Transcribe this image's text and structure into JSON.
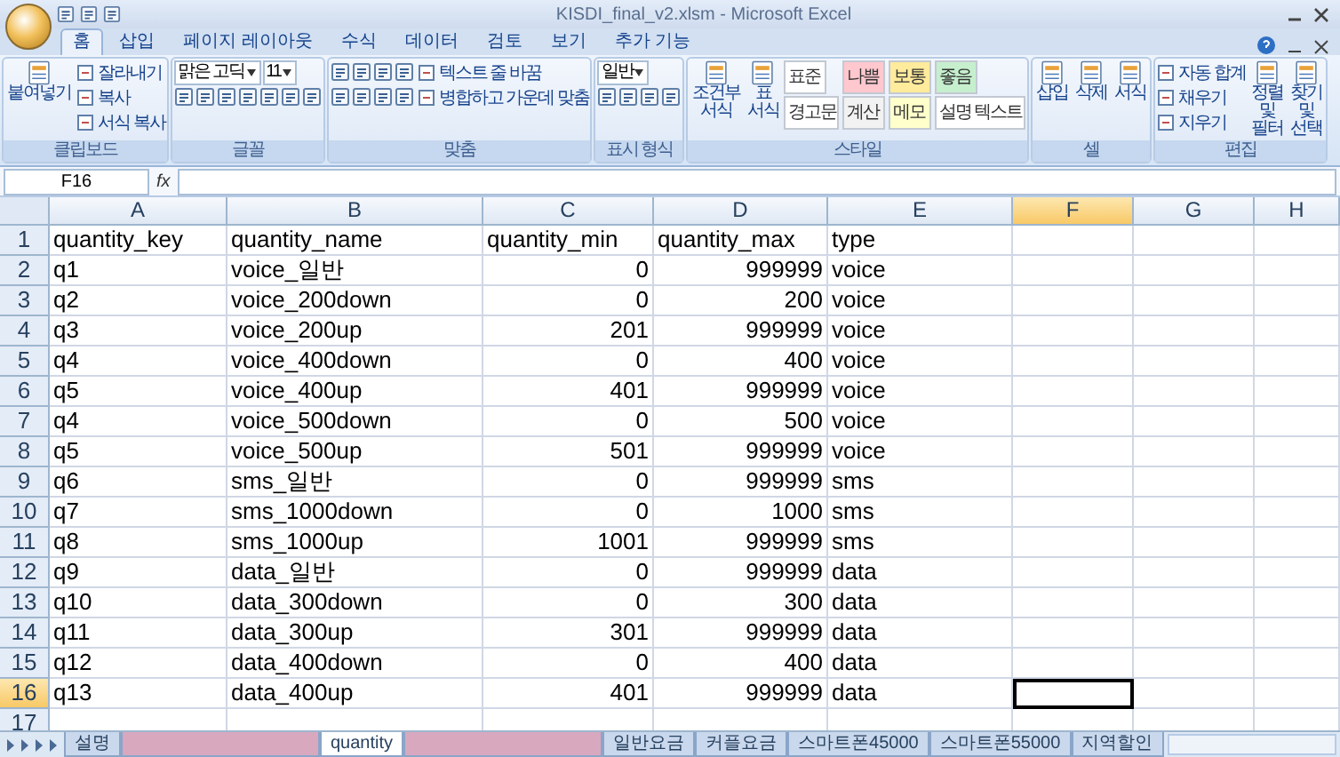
{
  "window": {
    "title": "KISDI_final_v2.xlsm - Microsoft Excel"
  },
  "ribbon": {
    "tabs": [
      {
        "label": "홈",
        "selected": true
      },
      {
        "label": "삽입",
        "selected": false
      },
      {
        "label": "페이지 레이아웃",
        "selected": false
      },
      {
        "label": "수식",
        "selected": false
      },
      {
        "label": "데이터",
        "selected": false
      },
      {
        "label": "검토",
        "selected": false
      },
      {
        "label": "보기",
        "selected": false
      },
      {
        "label": "추가 기능",
        "selected": false
      }
    ],
    "groups": [
      {
        "label": "클립보드",
        "columns": [
          [
            [
              {
                "kind": "large",
                "label": "붙여넣기"
              }
            ]
          ],
          [
            [
              {
                "kind": "small",
                "label": "잘라내기"
              }
            ],
            [
              {
                "kind": "small",
                "label": "복사"
              }
            ],
            [
              {
                "kind": "small",
                "label": "서식 복사"
              }
            ]
          ]
        ]
      },
      {
        "label": "글꼴",
        "columns": [
          [
            [
              {
                "kind": "select",
                "value": "맑은 고딕"
              },
              {
                "kind": "select",
                "value": "11"
              }
            ],
            [
              {
                "kind": "icon"
              },
              {
                "kind": "icon"
              },
              {
                "kind": "icon"
              },
              {
                "kind": "icon"
              },
              {
                "kind": "icon"
              },
              {
                "kind": "icon"
              },
              {
                "kind": "icon"
              }
            ]
          ]
        ]
      },
      {
        "label": "맞춤",
        "columns": [
          [
            [
              {
                "kind": "icon"
              },
              {
                "kind": "icon"
              },
              {
                "kind": "icon"
              },
              {
                "kind": "icon"
              }
            ],
            [
              {
                "kind": "icon"
              },
              {
                "kind": "icon"
              },
              {
                "kind": "icon"
              },
              {
                "kind": "icon"
              }
            ]
          ],
          [
            [
              {
                "kind": "small",
                "label": "텍스트 줄 바꿈"
              }
            ],
            [
              {
                "kind": "small",
                "label": "병합하고 가운데 맞춤"
              }
            ]
          ]
        ]
      },
      {
        "label": "표시 형식",
        "columns": [
          [
            [
              {
                "kind": "select",
                "value": "일반"
              }
            ],
            [
              {
                "kind": "icon"
              },
              {
                "kind": "icon"
              },
              {
                "kind": "icon"
              },
              {
                "kind": "icon"
              }
            ]
          ]
        ]
      },
      {
        "label": "스타일",
        "columns": [
          [
            [
              {
                "kind": "large",
                "label": "조건부 서식"
              }
            ]
          ],
          [
            [
              {
                "kind": "large",
                "label": "표 서식"
              }
            ]
          ],
          [
            [
              {
                "kind": "style",
                "label": "표준",
                "color": "#ffffff"
              }
            ],
            [
              {
                "kind": "style",
                "label": "경고문",
                "color": "#ffffff"
              }
            ]
          ],
          [
            [
              {
                "kind": "style",
                "label": "나쁨",
                "color": "#ffc7ce"
              }
            ],
            [
              {
                "kind": "style",
                "label": "계산",
                "color": "#f2f2f2"
              }
            ]
          ],
          [
            [
              {
                "kind": "style",
                "label": "보통",
                "color": "#ffeb9c"
              }
            ],
            [
              {
                "kind": "style",
                "label": "메모",
                "color": "#ffffcc"
              }
            ]
          ],
          [
            [
              {
                "kind": "style",
                "label": "좋음",
                "color": "#c6efce"
              }
            ],
            [
              {
                "kind": "style",
                "label": "설명 텍스트",
                "color": "#ffffff"
              }
            ]
          ]
        ]
      },
      {
        "label": "셀",
        "columns": [
          [
            [
              {
                "kind": "large",
                "label": "삽입"
              }
            ]
          ],
          [
            [
              {
                "kind": "large",
                "label": "삭제"
              }
            ]
          ],
          [
            [
              {
                "kind": "large",
                "label": "서식"
              }
            ]
          ]
        ]
      },
      {
        "label": "편집",
        "columns": [
          [
            [
              {
                "kind": "small",
                "label": "자동 합계"
              }
            ],
            [
              {
                "kind": "small",
                "label": "채우기"
              }
            ],
            [
              {
                "kind": "small",
                "label": "지우기"
              }
            ]
          ],
          [
            [
              {
                "kind": "large",
                "label": "정렬 및 필터"
              }
            ]
          ],
          [
            [
              {
                "kind": "large",
                "label": "찾기 및 선택"
              }
            ]
          ]
        ]
      }
    ]
  },
  "formula_bar": {
    "name_box": "F16",
    "function_label": "fx"
  },
  "columns": [
    {
      "label": "A",
      "selected": false
    },
    {
      "label": "B",
      "selected": false
    },
    {
      "label": "C",
      "selected": false
    },
    {
      "label": "D",
      "selected": false
    },
    {
      "label": "E",
      "selected": false
    },
    {
      "label": "F",
      "selected": true
    },
    {
      "label": "G",
      "selected": false
    },
    {
      "label": "H",
      "selected": false
    }
  ],
  "rows": [
    {
      "number": "1",
      "selected": false,
      "cells": [
        {
          "text": "quantity_key",
          "kind": "text"
        },
        {
          "text": "quantity_name",
          "kind": "text"
        },
        {
          "text": "quantity_min",
          "kind": "text"
        },
        {
          "text": "quantity_max",
          "kind": "text"
        },
        {
          "text": "type",
          "kind": "text"
        }
      ]
    },
    {
      "number": "2",
      "selected": false,
      "cells": [
        {
          "text": "q1",
          "kind": "text"
        },
        {
          "text": "voice_일반",
          "kind": "text"
        },
        {
          "text": "0",
          "kind": "number"
        },
        {
          "text": "999999",
          "kind": "number"
        },
        {
          "text": "voice",
          "kind": "text"
        }
      ]
    },
    {
      "number": "3",
      "selected": false,
      "cells": [
        {
          "text": "q2",
          "kind": "text"
        },
        {
          "text": "voice_200down",
          "kind": "text"
        },
        {
          "text": "0",
          "kind": "number"
        },
        {
          "text": "200",
          "kind": "number"
        },
        {
          "text": "voice",
          "kind": "text"
        }
      ]
    },
    {
      "number": "4",
      "selected": false,
      "cells": [
        {
          "text": "q3",
          "kind": "text"
        },
        {
          "text": "voice_200up",
          "kind": "text"
        },
        {
          "text": "201",
          "kind": "number"
        },
        {
          "text": "999999",
          "kind": "number"
        },
        {
          "text": "voice",
          "kind": "text"
        }
      ]
    },
    {
      "number": "5",
      "selected": false,
      "cells": [
        {
          "text": "q4",
          "kind": "text"
        },
        {
          "text": "voice_400down",
          "kind": "text"
        },
        {
          "text": "0",
          "kind": "number"
        },
        {
          "text": "400",
          "kind": "number"
        },
        {
          "text": "voice",
          "kind": "text"
        }
      ]
    },
    {
      "number": "6",
      "selected": false,
      "cells": [
        {
          "text": "q5",
          "kind": "text"
        },
        {
          "text": "voice_400up",
          "kind": "text"
        },
        {
          "text": "401",
          "kind": "number"
        },
        {
          "text": "999999",
          "kind": "number"
        },
        {
          "text": "voice",
          "kind": "text"
        }
      ]
    },
    {
      "number": "7",
      "selected": false,
      "cells": [
        {
          "text": "q4",
          "kind": "text"
        },
        {
          "text": "voice_500down",
          "kind": "text"
        },
        {
          "text": "0",
          "kind": "number"
        },
        {
          "text": "500",
          "kind": "number"
        },
        {
          "text": "voice",
          "kind": "text"
        }
      ]
    },
    {
      "number": "8",
      "selected": false,
      "cells": [
        {
          "text": "q5",
          "kind": "text"
        },
        {
          "text": "voice_500up",
          "kind": "text"
        },
        {
          "text": "501",
          "kind": "number"
        },
        {
          "text": "999999",
          "kind": "number"
        },
        {
          "text": "voice",
          "kind": "text"
        }
      ]
    },
    {
      "number": "9",
      "selected": false,
      "cells": [
        {
          "text": "q6",
          "kind": "text"
        },
        {
          "text": "sms_일반",
          "kind": "text"
        },
        {
          "text": "0",
          "kind": "number"
        },
        {
          "text": "999999",
          "kind": "number"
        },
        {
          "text": "sms",
          "kind": "text"
        }
      ]
    },
    {
      "number": "10",
      "selected": false,
      "cells": [
        {
          "text": "q7",
          "kind": "text"
        },
        {
          "text": "sms_1000down",
          "kind": "text"
        },
        {
          "text": "0",
          "kind": "number"
        },
        {
          "text": "1000",
          "kind": "number"
        },
        {
          "text": "sms",
          "kind": "text"
        }
      ]
    },
    {
      "number": "11",
      "selected": false,
      "cells": [
        {
          "text": "q8",
          "kind": "text"
        },
        {
          "text": "sms_1000up",
          "kind": "text"
        },
        {
          "text": "1001",
          "kind": "number"
        },
        {
          "text": "999999",
          "kind": "number"
        },
        {
          "text": "sms",
          "kind": "text"
        }
      ]
    },
    {
      "number": "12",
      "selected": false,
      "cells": [
        {
          "text": "q9",
          "kind": "text"
        },
        {
          "text": "data_일반",
          "kind": "text"
        },
        {
          "text": "0",
          "kind": "number"
        },
        {
          "text": "999999",
          "kind": "number"
        },
        {
          "text": "data",
          "kind": "text"
        }
      ]
    },
    {
      "number": "13",
      "selected": false,
      "cells": [
        {
          "text": "q10",
          "kind": "text"
        },
        {
          "text": "data_300down",
          "kind": "text"
        },
        {
          "text": "0",
          "kind": "number"
        },
        {
          "text": "300",
          "kind": "number"
        },
        {
          "text": "data",
          "kind": "text"
        }
      ]
    },
    {
      "number": "14",
      "selected": false,
      "cells": [
        {
          "text": "q11",
          "kind": "text"
        },
        {
          "text": "data_300up",
          "kind": "text"
        },
        {
          "text": "301",
          "kind": "number"
        },
        {
          "text": "999999",
          "kind": "number"
        },
        {
          "text": "data",
          "kind": "text"
        }
      ]
    },
    {
      "number": "15",
      "selected": false,
      "cells": [
        {
          "text": "q12",
          "kind": "text"
        },
        {
          "text": "data_400down",
          "kind": "text"
        },
        {
          "text": "0",
          "kind": "number"
        },
        {
          "text": "400",
          "kind": "number"
        },
        {
          "text": "data",
          "kind": "text"
        }
      ]
    },
    {
      "number": "16",
      "selected": true,
      "cells": [
        {
          "text": "q13",
          "kind": "text"
        },
        {
          "text": "data_400up",
          "kind": "text"
        },
        {
          "text": "401",
          "kind": "number"
        },
        {
          "text": "999999",
          "kind": "number"
        },
        {
          "text": "data",
          "kind": "text"
        }
      ]
    },
    {
      "number": "17",
      "selected": false,
      "cells": []
    }
  ],
  "sheet_tabs": [
    {
      "kind": "normal",
      "label": "설명",
      "selected": false
    },
    {
      "kind": "redacted",
      "selected": false
    },
    {
      "kind": "normal",
      "label": "quantity",
      "selected": true
    },
    {
      "kind": "redacted",
      "selected": false
    },
    {
      "kind": "normal",
      "label": "일반요금",
      "selected": false
    },
    {
      "kind": "normal",
      "label": "커플요금",
      "selected": false
    },
    {
      "kind": "normal",
      "label": "스마트폰45000",
      "selected": false
    },
    {
      "kind": "normal",
      "label": "스마트폰55000",
      "selected": false
    },
    {
      "kind": "normal",
      "label": "지역할인",
      "selected": false
    }
  ]
}
